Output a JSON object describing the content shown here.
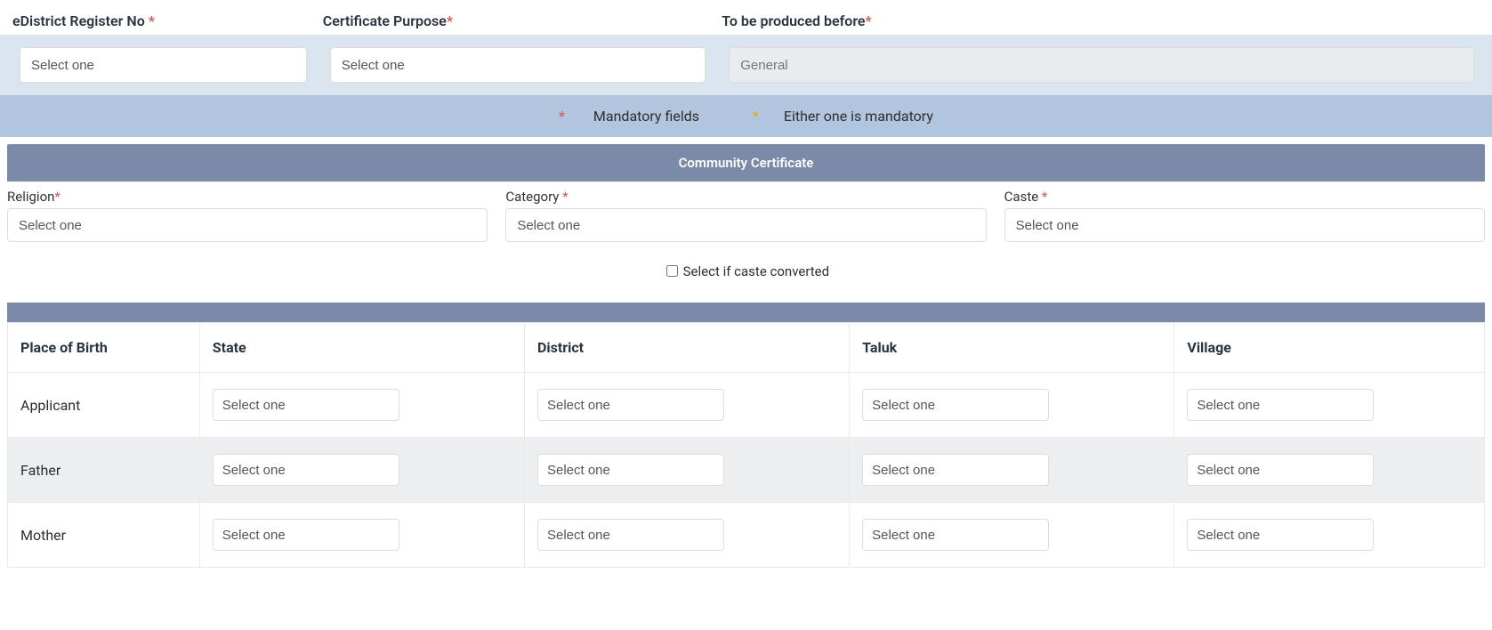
{
  "top": {
    "reg_label": "eDistrict Register No ",
    "purp_label": "Certificate Purpose",
    "prod_label": "To be produced before",
    "select_one": "Select one",
    "produced_value": "General"
  },
  "legend": {
    "mandatory": " Mandatory fields",
    "either": "Either one is mandatory"
  },
  "cc": {
    "header": "Community Certificate",
    "religion_label": "Religion",
    "category_label": "Category ",
    "caste_label": "Caste ",
    "select_one": "Select one",
    "caste_conv": "Select if caste converted"
  },
  "birth": {
    "hdr": [
      "Place of Birth",
      "State",
      "District",
      "Taluk",
      "Village"
    ],
    "rows": [
      "Applicant",
      "Father",
      "Mother"
    ],
    "select_one": "Select one"
  }
}
